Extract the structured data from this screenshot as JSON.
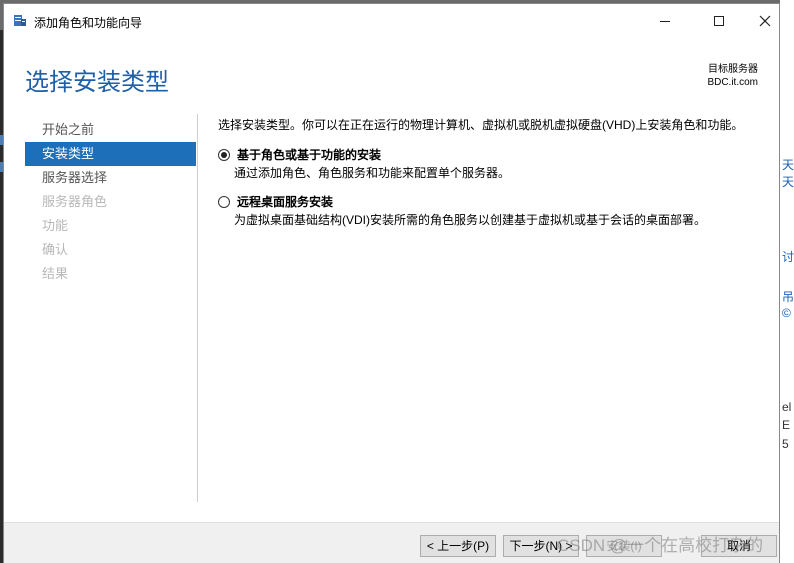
{
  "window": {
    "title": "添加角色和功能向导"
  },
  "header": {
    "page_title": "选择安装类型",
    "target_label": "目标服务器",
    "target_server": "BDC.it.com"
  },
  "sidebar": {
    "items": [
      {
        "label": "开始之前",
        "state": "normal"
      },
      {
        "label": "安装类型",
        "state": "active"
      },
      {
        "label": "服务器选择",
        "state": "normal"
      },
      {
        "label": "服务器角色",
        "state": "disabled"
      },
      {
        "label": "功能",
        "state": "disabled"
      },
      {
        "label": "确认",
        "state": "disabled"
      },
      {
        "label": "结果",
        "state": "disabled"
      }
    ]
  },
  "main": {
    "intro": "选择安装类型。你可以在正在运行的物理计算机、虚拟机或脱机虚拟硬盘(VHD)上安装角色和功能。",
    "options": [
      {
        "label": "基于角色或基于功能的安装",
        "description": "通过添加角色、角色服务和功能来配置单个服务器。",
        "selected": true
      },
      {
        "label": "远程桌面服务安装",
        "description": "为虚拟桌面基础结构(VDI)安装所需的角色服务以创建基于虚拟机或基于会话的桌面部署。",
        "selected": false
      }
    ]
  },
  "footer": {
    "prev_label": "< 上一步(P)",
    "next_label": "下一步(N) >",
    "install_label": "安装(I)",
    "cancel_label": "取消"
  },
  "watermark": "CSDN @一个在高校打杂的",
  "background_window": {
    "fragments": [
      "天",
      "天",
      "讨",
      "吊",
      "©",
      "el",
      "E",
      "5"
    ]
  },
  "colors": {
    "accent": "#1e6fb9",
    "title_blue": "#1d5fa8"
  }
}
